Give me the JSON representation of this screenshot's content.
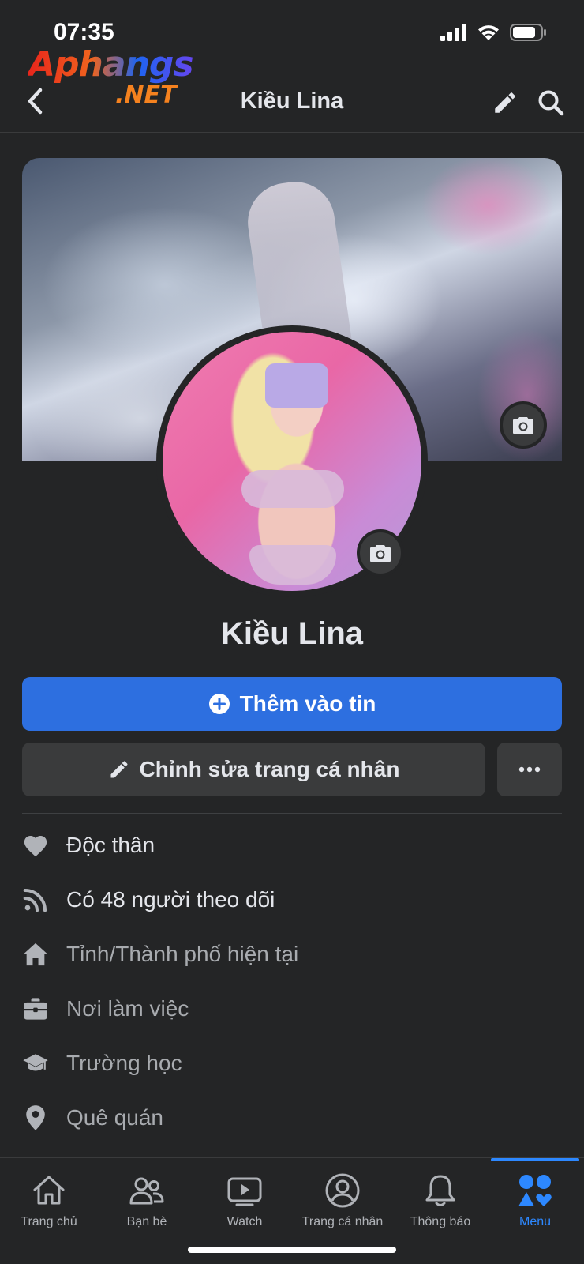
{
  "status_bar": {
    "time": "07:35"
  },
  "watermark": {
    "line1": "Aphangs",
    "line2": ".NET"
  },
  "nav": {
    "title": "Kiều Lina"
  },
  "profile": {
    "name": "Kiều Lina"
  },
  "actions": {
    "add_story_label": "Thêm vào tin",
    "edit_profile_label": "Chỉnh sửa trang cá nhân",
    "more_label": "···"
  },
  "info": {
    "items": [
      {
        "icon": "heart-icon",
        "text": "Độc thân"
      },
      {
        "icon": "rss-icon",
        "text": "Có 48 người theo dõi"
      },
      {
        "icon": "home-icon",
        "text": "Tỉnh/Thành phố hiện tại"
      },
      {
        "icon": "briefcase-icon",
        "text": "Nơi làm việc"
      },
      {
        "icon": "graduation-cap-icon",
        "text": "Trường học"
      },
      {
        "icon": "location-pin-icon",
        "text": "Quê quán"
      }
    ]
  },
  "tabs": [
    {
      "label": "Trang chủ",
      "icon": "home-outline-icon"
    },
    {
      "label": "Bạn bè",
      "icon": "friends-icon"
    },
    {
      "label": "Watch",
      "icon": "watch-icon"
    },
    {
      "label": "Trang cá nhân",
      "icon": "profile-icon"
    },
    {
      "label": "Thông báo",
      "icon": "bell-icon"
    },
    {
      "label": "Menu",
      "icon": "menu-shapes-icon",
      "active": true
    }
  ],
  "colors": {
    "background": "#242526",
    "primary": "#2d6fe0",
    "accent_active": "#2d88ff",
    "secondary_button": "#3a3b3c",
    "text_primary": "#e4e6eb",
    "text_muted": "#a8abaf"
  }
}
